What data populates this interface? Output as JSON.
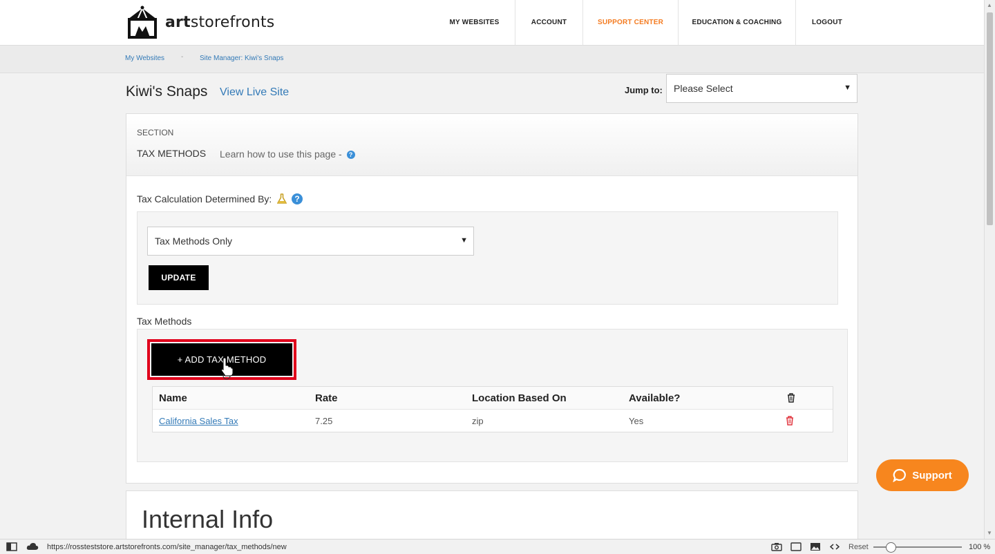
{
  "header": {
    "brand_bold": "art",
    "brand_rest": "storefronts",
    "nav": [
      {
        "label": "MY WEBSITES",
        "active": false
      },
      {
        "label": "ACCOUNT",
        "active": false
      },
      {
        "label": "SUPPORT CENTER",
        "active": true
      },
      {
        "label": "EDUCATION & COACHING",
        "active": false
      },
      {
        "label": "LOGOUT",
        "active": false
      }
    ]
  },
  "breadcrumb": {
    "items": [
      "My Websites",
      "Site Manager: Kiwi's Snaps"
    ],
    "separator": "-"
  },
  "page": {
    "site_title": "Kiwi's Snaps",
    "view_live_label": "View Live Site",
    "jump_label": "Jump to:",
    "jump_value": "Please Select"
  },
  "section": {
    "label": "SECTION",
    "name": "TAX METHODS",
    "learn_text": "Learn how to use this page -",
    "help_icon": "?"
  },
  "tax_calc": {
    "label": "Tax Calculation Determined By:",
    "selected": "Tax Methods Only",
    "update_label": "UPDATE"
  },
  "tax_methods": {
    "label": "Tax Methods",
    "add_label": "+ ADD TAX METHOD",
    "columns": [
      "Name",
      "Rate",
      "Location Based On",
      "Available?"
    ],
    "rows": [
      {
        "name": "California Sales Tax",
        "rate": "7.25",
        "location": "zip",
        "available": "Yes"
      }
    ]
  },
  "internal_info": {
    "title": "Internal Info"
  },
  "support": {
    "label": "Support"
  },
  "statusbar": {
    "url": "https://rossteststore.artstorefronts.com/site_manager/tax_methods/new",
    "reset_label": "Reset",
    "zoom": "100 %"
  },
  "colors": {
    "accent": "#f47b20",
    "link": "#337ab7",
    "highlight": "#e0001b",
    "support": "#f7861e"
  }
}
